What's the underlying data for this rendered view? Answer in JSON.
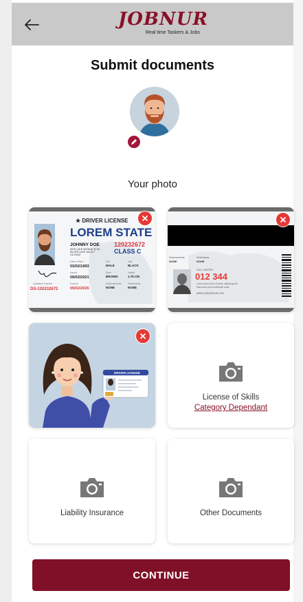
{
  "header": {
    "logo_text": "JOBNUR",
    "logo_tagline": "Real time Taskers & Jobs"
  },
  "page": {
    "title": "Submit documents",
    "photo_label": "Your photo"
  },
  "cards": {
    "license_front": {
      "heading": "★ DRIVER LICENSE",
      "state": "LOREM STATE",
      "name": "JOHNNY DOE",
      "address1": "SIDE LAKE AVENUE 32 EU",
      "address2": "SILVER LAKE VALLEY",
      "address3": "CA 23162",
      "number": "120232672",
      "class": "CLASS C",
      "dob_label": "Date of Birth",
      "dob": "03/02/1993",
      "issued_label": "Issued",
      "issued": "09/02/2021",
      "expires_label": "Expires",
      "expires": "09/02/2026",
      "sex_label": "Sex",
      "sex": "MALE",
      "hair_label": "Hair",
      "hair": "BLACK",
      "eyes_label": "Eyes",
      "eyes": "BROWN",
      "height_label": "Height",
      "height": "1.78 CM",
      "endorse_label": "Endorsements",
      "endorse": "NONE",
      "restrict_label": "Restrictions",
      "restrict": "NONE",
      "valid_label": "Validation Number",
      "valid_number": "DS-120232672"
    },
    "license_back": {
      "endorse_label": "Endorsements",
      "endorse": "NONE",
      "restrict_label": "Restrictions",
      "restrict": "NONE",
      "cal_label": "CALL CENTER",
      "number": "012 344",
      "fine1": "Lorem ipsum dolor sit amet, adipiscing elit.",
      "fine2": "Maecenas purus sollicitudin porta.",
      "website": "WWW.LOREMIPSUM.COM"
    },
    "selfie": {
      "card_text": "DRIVER LICENSE"
    },
    "skills": {
      "label": "License of Skills",
      "link": "Category Dependant"
    },
    "insurance": {
      "label": "Liability Insurance"
    },
    "other": {
      "label": "Other Documents"
    }
  },
  "actions": {
    "continue_label": "CONTINUE"
  },
  "colors": {
    "brand": "#801027",
    "close_red": "#e53935",
    "topbar": "#c9c9c9"
  },
  "icons": {
    "back": "arrow-left-icon",
    "edit": "pencil-icon",
    "close": "close-icon",
    "camera": "camera-icon"
  }
}
